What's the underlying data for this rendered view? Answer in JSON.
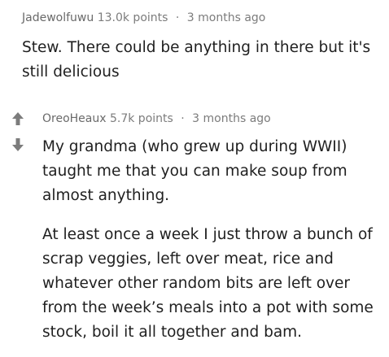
{
  "comments": [
    {
      "author": "Jadewolfuwu",
      "points": "13.0k points",
      "separator": "·",
      "time": "3 months ago",
      "paragraphs": [
        "Stew. There could be anything in there but it's still delicious"
      ]
    },
    {
      "author": "OreoHeaux",
      "points": "5.7k points",
      "separator": "·",
      "time": "3 months ago",
      "paragraphs": [
        "My grandma (who grew up during WWII) taught me that you can make soup from almost anything.",
        "At least once a week I just throw a bunch of scrap veggies, left over meat, rice and whatever other random bits are left over from the week’s meals into a pot with some stock, boil it all together and bam."
      ]
    }
  ],
  "icons": {
    "upvote": "upvote-arrow-icon",
    "downvote": "downvote-arrow-icon",
    "color": "#7c7c7c"
  }
}
